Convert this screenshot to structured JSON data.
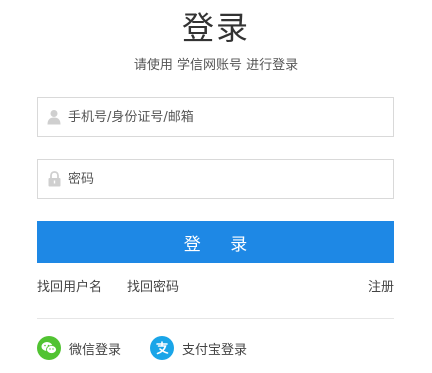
{
  "header": {
    "title": "登录",
    "subtitle": "请使用 学信网账号 进行登录"
  },
  "form": {
    "username_placeholder": "手机号/身份证号/邮箱",
    "username_value": "",
    "password_placeholder": "密码",
    "password_value": "",
    "submit_label": "登 录"
  },
  "links": {
    "recover_username": "找回用户名",
    "recover_password": "找回密码",
    "register": "注册"
  },
  "social": {
    "wechat_label": "微信登录",
    "alipay_label": "支付宝登录",
    "wechat_icon": "wechat-icon",
    "alipay_icon": "alipay-icon"
  },
  "colors": {
    "primary": "#1e88e5",
    "wechat": "#51c332",
    "alipay": "#1aa5e8"
  }
}
